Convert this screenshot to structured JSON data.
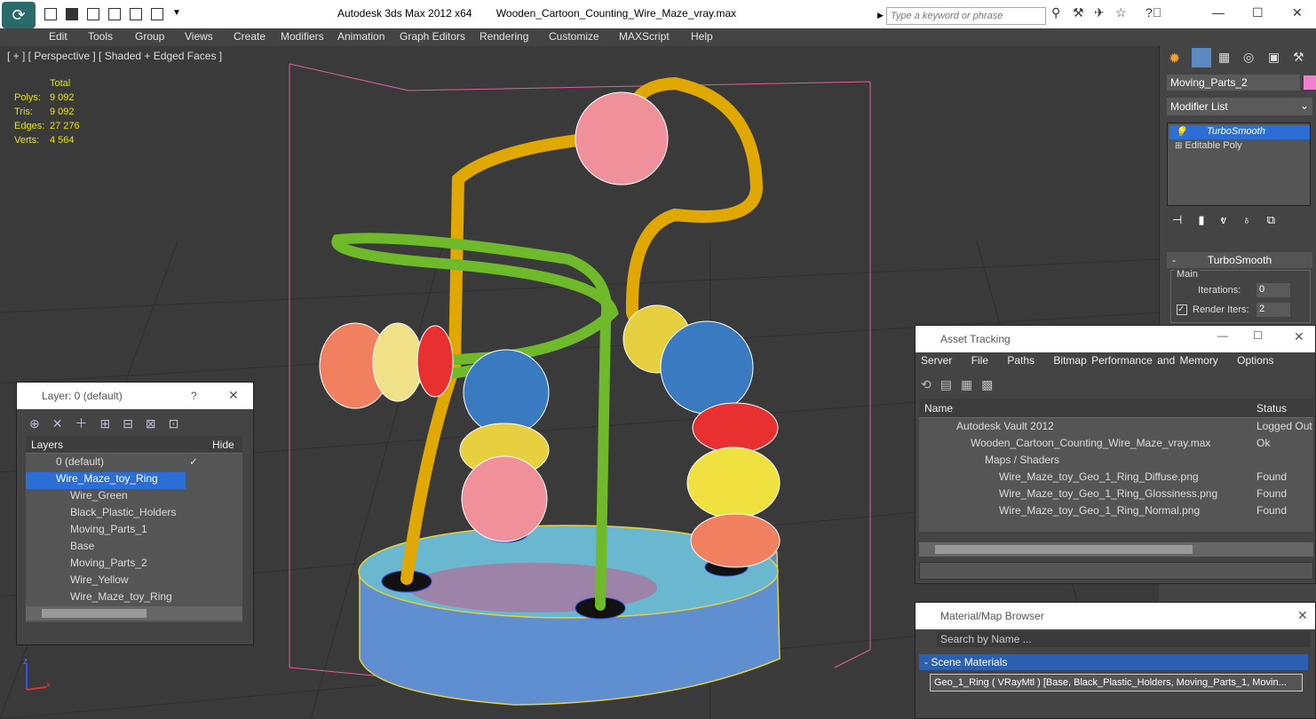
{
  "titlebar": {
    "app": "Autodesk 3ds Max  2012 x64",
    "file": "Wooden_Cartoon_Counting_Wire_Maze_vray.max",
    "search_placeholder": "Type a keyword or phrase"
  },
  "menu": [
    "Edit",
    "Tools",
    "Group",
    "Views",
    "Create",
    "Modifiers",
    "Animation",
    "Graph Editors",
    "Rendering",
    "Customize",
    "MAXScript",
    "Help"
  ],
  "viewport": {
    "label": "[ + ] [ Perspective ] [ Shaded + Edged Faces ]",
    "stats": {
      "total": "Total",
      "polys_l": "Polys:",
      "polys": "9 092",
      "tris_l": "Tris:",
      "tris": "9 092",
      "edges_l": "Edges:",
      "edges": "27 276",
      "verts_l": "Verts:",
      "verts": "4 564"
    },
    "axis": {
      "z": "z",
      "x": "x"
    }
  },
  "command_panel": {
    "object_name": "Moving_Parts_2",
    "object_color": "#f080d0",
    "modifier_list": "Modifier List",
    "stack": [
      "TurboSmooth",
      "Editable Poly"
    ],
    "rollout_title": "TurboSmooth",
    "group": "Main",
    "iterations_l": "Iterations:",
    "iterations": "0",
    "render_iters_l": "Render Iters:",
    "render_iters": "2"
  },
  "layers": {
    "title": "Layer: 0 (default)",
    "help": "?",
    "col_layers": "Layers",
    "col_hide": "Hide",
    "items": [
      "0 (default)",
      "Wire_Maze_toy_Ring",
      "Wire_Green",
      "Black_Plastic_Holders",
      "Moving_Parts_1",
      "Base",
      "Moving_Parts_2",
      "Wire_Yellow",
      "Wire_Maze_toy_Ring"
    ]
  },
  "assets": {
    "title": "Asset Tracking",
    "menu": [
      "Server",
      "File",
      "Paths",
      "Bitmap Performance and Memory",
      "Options"
    ],
    "col_name": "Name",
    "col_status": "Status",
    "rows": [
      {
        "name": "Autodesk Vault 2012",
        "status": "Logged Out"
      },
      {
        "name": "Wooden_Cartoon_Counting_Wire_Maze_vray.max",
        "status": "Ok"
      },
      {
        "name": "Maps / Shaders",
        "status": ""
      },
      {
        "name": "Wire_Maze_toy_Geo_1_Ring_Diffuse.png",
        "status": "Found"
      },
      {
        "name": "Wire_Maze_toy_Geo_1_Ring_Glossiness.png",
        "status": "Found"
      },
      {
        "name": "Wire_Maze_toy_Geo_1_Ring_Normal.png",
        "status": "Found"
      }
    ]
  },
  "matbrowser": {
    "title": "Material/Map Browser",
    "search": "Search by Name ...",
    "section": "- Scene Materials",
    "item": "Geo_1_Ring ( VRayMtl ) [Base, Black_Plastic_Holders, Moving_Parts_1, Movin..."
  }
}
